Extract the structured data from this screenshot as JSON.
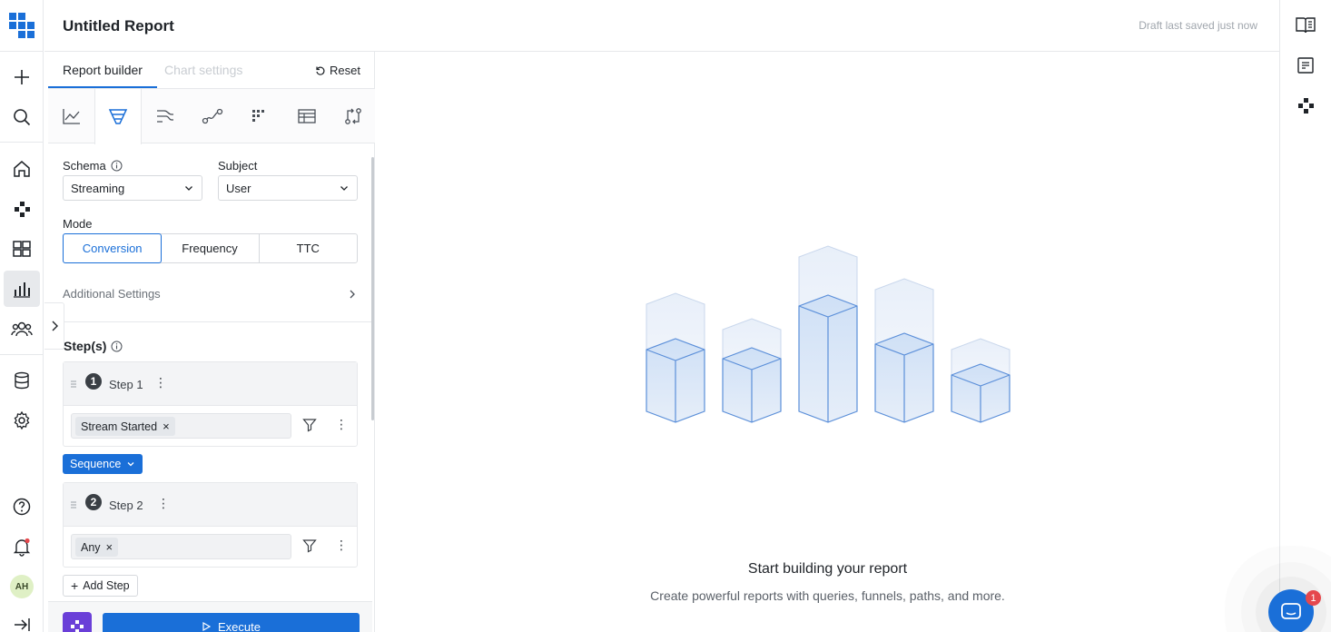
{
  "header": {
    "title": "Untitled Report",
    "saved_status": "Draft last saved just now"
  },
  "rail": {
    "icons": [
      "logo-icon",
      "plus-icon",
      "search-icon",
      "home-icon",
      "network-icon",
      "dashboard-icon",
      "bar-chart-icon",
      "users-icon",
      "database-icon",
      "gear-icon",
      "help-icon",
      "bell-icon",
      "expand-icon"
    ],
    "avatar": "AH"
  },
  "panel": {
    "tabs": [
      {
        "label": "Report builder"
      },
      {
        "label": "Chart settings"
      }
    ],
    "reset_label": "Reset",
    "toolbar_icons": [
      "line-chart-icon",
      "funnel-icon",
      "flow-icon",
      "path-icon",
      "grid-icon",
      "table-icon",
      "compare-icon"
    ],
    "schema": {
      "label": "Schema",
      "value": "Streaming"
    },
    "subject": {
      "label": "Subject",
      "value": "User"
    },
    "mode": {
      "label": "Mode",
      "options": [
        "Conversion",
        "Frequency",
        "TTC"
      ],
      "selected": "Conversion"
    },
    "additional_settings": "Additional Settings",
    "steps_heading": "Step(s)",
    "steps": [
      {
        "number": "1",
        "name": "Step 1",
        "event": "Stream Started"
      },
      {
        "number": "2",
        "name": "Step 2",
        "event": "Any"
      }
    ],
    "sequence_label": "Sequence",
    "add_step_label": "Add Step",
    "execute_label": "Execute"
  },
  "main": {
    "empty_title": "Start building your report",
    "empty_subtitle": "Create powerful reports with queries, funnels, paths, and more."
  },
  "chat": {
    "badge": "1"
  },
  "colors": {
    "accent": "#1a6fd8",
    "execute_logo": "#6a3fd8",
    "badge": "#e5484d"
  }
}
